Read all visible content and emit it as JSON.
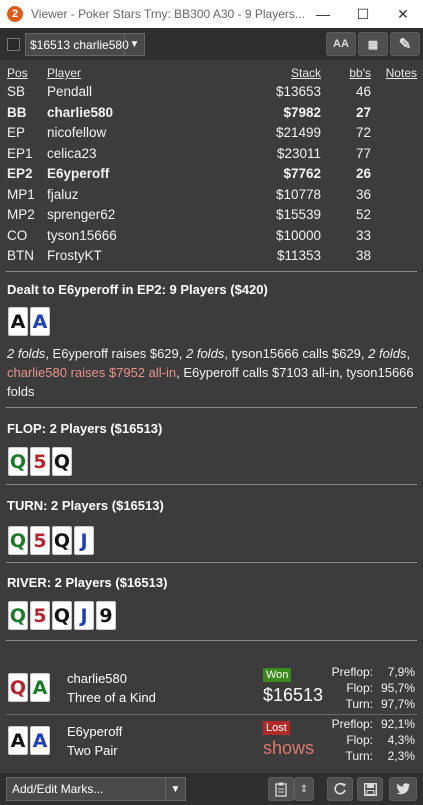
{
  "window": {
    "title": "Viewer - Poker Stars Trny: BB300 A30 - 9 Players...",
    "app_icon": "2",
    "minimize": "—",
    "maximize": "☐",
    "close": "✕"
  },
  "toolbar": {
    "hand_select": "$16513 charlie580",
    "font_button": "AA",
    "grid_button": "▦",
    "edit_button": "✎"
  },
  "table": {
    "headers": {
      "pos": "Pos",
      "player": "Player",
      "stack": "Stack",
      "bbs": "bb's",
      "notes": "Notes"
    },
    "rows": [
      {
        "pos": "SB",
        "player": "Pendall",
        "stack": "$13653",
        "bbs": "46",
        "bold": false
      },
      {
        "pos": "BB",
        "player": "charlie580",
        "stack": "$7982",
        "bbs": "27",
        "bold": true
      },
      {
        "pos": "EP",
        "player": "nicofellow",
        "stack": "$21499",
        "bbs": "72",
        "bold": false
      },
      {
        "pos": "EP1",
        "player": "celica23",
        "stack": "$23011",
        "bbs": "77",
        "bold": false
      },
      {
        "pos": "EP2",
        "player": "E6yperoff",
        "stack": "$7762",
        "bbs": "26",
        "bold": true
      },
      {
        "pos": "MP1",
        "player": "fjaluz",
        "stack": "$10778",
        "bbs": "36",
        "bold": false
      },
      {
        "pos": "MP2",
        "player": "sprenger62",
        "stack": "$15539",
        "bbs": "52",
        "bold": false
      },
      {
        "pos": "CO",
        "player": "tyson15666",
        "stack": "$10000",
        "bbs": "33",
        "bold": false
      },
      {
        "pos": "BTN",
        "player": "FrostyKT",
        "stack": "$11353",
        "bbs": "38",
        "bold": false
      }
    ]
  },
  "preflop": {
    "title": "Dealt to E6yperoff in EP2: 9 Players ($420)",
    "cards": [
      {
        "rank": "A",
        "suit": "s"
      },
      {
        "rank": "A",
        "suit": "h"
      }
    ],
    "action": {
      "p1": "2 folds",
      "p2": ", E6yperoff raises $629, ",
      "p3": "2 folds",
      "p4": ", tyson15666 calls $629, ",
      "p5": "2 folds",
      "p6": ", ",
      "p7": "charlie580 raises $7952 all-in",
      "p8": ", E6yperoff calls $7103 all-in, tyson15666 folds"
    }
  },
  "flop": {
    "title": "FLOP: 2 Players ($16513)",
    "cards": [
      {
        "rank": "Q",
        "suit": "c"
      },
      {
        "rank": "5",
        "suit": "d"
      },
      {
        "rank": "Q",
        "suit": "s"
      }
    ]
  },
  "turn": {
    "title": "TURN: 2 Players ($16513)",
    "cards": [
      {
        "rank": "Q",
        "suit": "c"
      },
      {
        "rank": "5",
        "suit": "d"
      },
      {
        "rank": "Q",
        "suit": "s"
      },
      {
        "rank": "J",
        "suit": "h"
      }
    ]
  },
  "river": {
    "title": "RIVER: 2 Players ($16513)",
    "cards": [
      {
        "rank": "Q",
        "suit": "c"
      },
      {
        "rank": "5",
        "suit": "d"
      },
      {
        "rank": "Q",
        "suit": "s"
      },
      {
        "rank": "J",
        "suit": "h"
      },
      {
        "rank": "9",
        "suit": "s"
      }
    ]
  },
  "results": [
    {
      "name": "charlie580",
      "hand": "Three of a Kind",
      "cards": [
        {
          "rank": "Q",
          "suit": "d"
        },
        {
          "rank": "A",
          "suit": "c"
        }
      ],
      "badge": "Won",
      "amount": "$16513",
      "equity": {
        "preflop_label": "Preflop:",
        "preflop": "7,9%",
        "flop_label": "Flop:",
        "flop": "95,7%",
        "turn_label": "Turn:",
        "turn": "97,7%"
      }
    },
    {
      "name": "E6yperoff",
      "hand": "Two Pair",
      "cards": [
        {
          "rank": "A",
          "suit": "s"
        },
        {
          "rank": "A",
          "suit": "h"
        }
      ],
      "badge": "Lost",
      "amount": "shows",
      "equity": {
        "preflop_label": "Preflop:",
        "preflop": "92,1%",
        "flop_label": "Flop:",
        "flop": "4,3%",
        "turn_label": "Turn:",
        "turn": "2,3%"
      }
    }
  ],
  "bottom": {
    "marks_select": "Add/Edit Marks...",
    "icons": {
      "clipboard": "clipboard-icon",
      "updown": "sort-icon",
      "refresh": "refresh-icon",
      "save": "save-icon",
      "twitter": "twitter-icon"
    }
  },
  "colors": {
    "won": "#3a8a1e",
    "lost": "#b02a2a",
    "highlight": "#e8928a",
    "spade": "#111111",
    "heart": "#1f3fb5",
    "diamond": "#b8232d",
    "club": "#1a7a2a"
  }
}
